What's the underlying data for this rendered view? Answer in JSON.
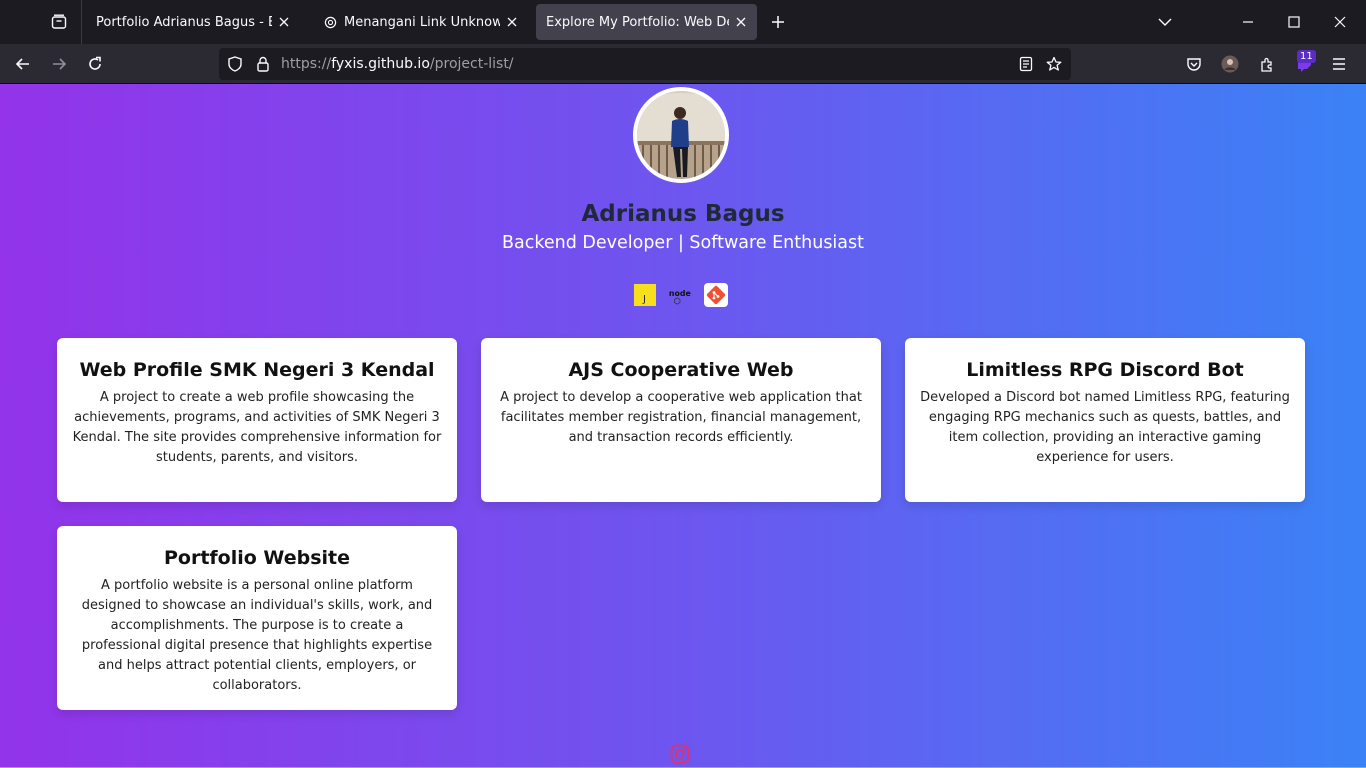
{
  "browser": {
    "tabs": [
      {
        "title": "Portfolio Adrianus Bagus - Backend Developer",
        "active": false
      },
      {
        "title": "Menangani Link Unknown",
        "active": false
      },
      {
        "title": "Explore My Portfolio: Web Developer",
        "active": true
      }
    ],
    "url": {
      "prefix": "https://",
      "host": "fyxis.github.io",
      "path": "/project-list/"
    },
    "extensions_badge": "11",
    "icons": [
      "tab-overview-icon",
      "chatgpt-icon",
      "close-icon",
      "plus-icon",
      "chevron-down-icon",
      "minimize-icon",
      "maximize-icon",
      "back-icon",
      "forward-icon",
      "reload-icon",
      "shield-icon",
      "lock-icon",
      "reader-mode-icon",
      "star-icon",
      "pocket-icon",
      "account-avatar-icon",
      "extensions-icon",
      "hamburger-menu-icon"
    ]
  },
  "profile": {
    "name": "Adrianus Bagus",
    "role": "Backend Developer | Software Enthusiast",
    "tech": [
      {
        "name": "javascript",
        "label": "J",
        "color": "#f7df1e"
      },
      {
        "name": "nodejs",
        "label": "node",
        "color": "#ffffff"
      },
      {
        "name": "git",
        "label": "git",
        "color": "#f05032"
      }
    ]
  },
  "projects": [
    {
      "title": "Web Profile SMK Negeri 3 Kendal",
      "description": "A project to create a web profile showcasing the achievements, programs, and activities of SMK Negeri 3 Kendal. The site provides comprehensive information for students, parents, and visitors."
    },
    {
      "title": "AJS Cooperative Web",
      "description": "A project to develop a cooperative web application that facilitates member registration, financial management, and transaction records efficiently."
    },
    {
      "title": "Limitless RPG Discord Bot",
      "description": "Developed a Discord bot named Limitless RPG, featuring engaging RPG mechanics such as quests, battles, and item collection, providing an interactive gaming experience for users."
    },
    {
      "title": "Portfolio Website",
      "description": "A portfolio website is a personal online platform designed to showcase an individual's skills, work, and accomplishments. The purpose is to create a professional digital presence that highlights expertise and helps attract potential clients, employers, or collaborators."
    }
  ],
  "colors": {
    "gradient_start": "#9333ea",
    "gradient_end": "#3b82f6",
    "name_color": "#1f2937",
    "browser_bg": "#1c1b22"
  }
}
